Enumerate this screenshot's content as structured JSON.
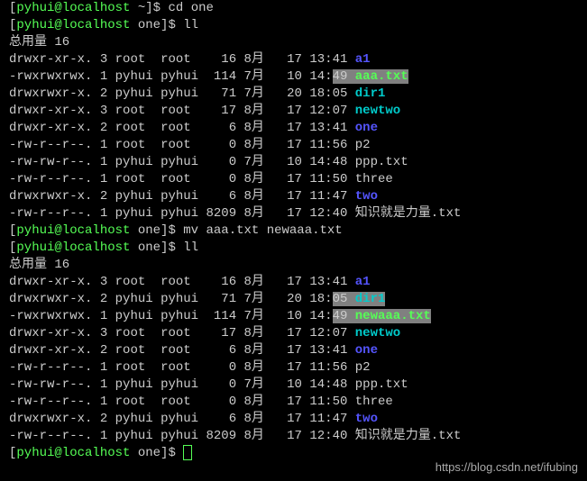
{
  "prompt1": {
    "user": "pyhui",
    "at": "@",
    "host": "localhost",
    "path": " ~]",
    "dollar": "$ ",
    "cmd": "cd one"
  },
  "prompt2": {
    "user": "pyhui",
    "at": "@",
    "host": "localhost",
    "path": " one]",
    "dollar": "$ ",
    "cmd": "ll"
  },
  "total1": "总用量 16",
  "ls1": [
    {
      "perm": "drwxr-xr-x.",
      "l": "3",
      "u": "root ",
      "g": "root ",
      "sz": "  16",
      "m": "8月 ",
      "d": "17",
      "t": "13:",
      "mm": "41",
      "name": "a1",
      "cls": "dir"
    },
    {
      "perm": "-rwxrwxrwx.",
      "l": "1",
      "u": "pyhui",
      "g": "pyhui",
      "sz": " 114",
      "m": "7月 ",
      "d": "10",
      "t": "14:",
      "mm": "49",
      "name": "aaa.txt",
      "cls": "fileg",
      "hl": true
    },
    {
      "perm": "drwxrwxr-x.",
      "l": "2",
      "u": "pyhui",
      "g": "pyhui",
      "sz": "  71",
      "m": "7月 ",
      "d": "20",
      "t": "18:",
      "mm": "05",
      "name": "dir1",
      "cls": "dirteal"
    },
    {
      "perm": "drwxr-xr-x.",
      "l": "3",
      "u": "root ",
      "g": "root ",
      "sz": "  17",
      "m": "8月 ",
      "d": "17",
      "t": "12:",
      "mm": "07",
      "name": "newtwo",
      "cls": "dirteal"
    },
    {
      "perm": "drwxr-xr-x.",
      "l": "2",
      "u": "root ",
      "g": "root ",
      "sz": "   6",
      "m": "8月 ",
      "d": "17",
      "t": "13:",
      "mm": "41",
      "name": "one",
      "cls": "dir"
    },
    {
      "perm": "-rw-r--r--.",
      "l": "1",
      "u": "root ",
      "g": "root ",
      "sz": "   0",
      "m": "8月 ",
      "d": "17",
      "t": "11:",
      "mm": "56",
      "name": "p2",
      "cls": "normal"
    },
    {
      "perm": "-rw-rw-r--.",
      "l": "1",
      "u": "pyhui",
      "g": "pyhui",
      "sz": "   0",
      "m": "7月 ",
      "d": "10",
      "t": "14:",
      "mm": "48",
      "name": "ppp.txt",
      "cls": "normal"
    },
    {
      "perm": "-rw-r--r--.",
      "l": "1",
      "u": "root ",
      "g": "root ",
      "sz": "   0",
      "m": "8月 ",
      "d": "17",
      "t": "11:",
      "mm": "50",
      "name": "three",
      "cls": "normal"
    },
    {
      "perm": "drwxrwxr-x.",
      "l": "2",
      "u": "pyhui",
      "g": "pyhui",
      "sz": "   6",
      "m": "8月 ",
      "d": "17",
      "t": "11:",
      "mm": "47",
      "name": "two",
      "cls": "dir"
    },
    {
      "perm": "-rw-r--r--.",
      "l": "1",
      "u": "pyhui",
      "g": "pyhui",
      "sz": "8209",
      "m": "8月 ",
      "d": "17",
      "t": "12:",
      "mm": "40",
      "name": "知识就是力量.txt",
      "cls": "normal"
    }
  ],
  "prompt3": {
    "user": "pyhui",
    "at": "@",
    "host": "localhost",
    "path": " one]",
    "dollar": "$ ",
    "cmd": "mv aaa.txt newaaa.txt"
  },
  "prompt4": {
    "user": "pyhui",
    "at": "@",
    "host": "localhost",
    "path": " one]",
    "dollar": "$ ",
    "cmd": "ll"
  },
  "total2": "总用量 16",
  "ls2": [
    {
      "perm": "drwxr-xr-x.",
      "l": "3",
      "u": "root ",
      "g": "root ",
      "sz": "  16",
      "m": "8月 ",
      "d": "17",
      "t": "13:",
      "mm": "41",
      "name": "a1",
      "cls": "dir"
    },
    {
      "perm": "drwxrwxr-x.",
      "l": "2",
      "u": "pyhui",
      "g": "pyhui",
      "sz": "  71",
      "m": "7月 ",
      "d": "20",
      "t": "18:",
      "mm": "05",
      "name": "dir1",
      "cls": "dirteal",
      "hl": true
    },
    {
      "perm": "-rwxrwxrwx.",
      "l": "1",
      "u": "pyhui",
      "g": "pyhui",
      "sz": " 114",
      "m": "7月 ",
      "d": "10",
      "t": "14:",
      "mm": "49",
      "name": "newaaa.txt",
      "cls": "fileg",
      "hl": true
    },
    {
      "perm": "drwxr-xr-x.",
      "l": "3",
      "u": "root ",
      "g": "root ",
      "sz": "  17",
      "m": "8月 ",
      "d": "17",
      "t": "12:",
      "mm": "07",
      "name": "newtwo",
      "cls": "dirteal"
    },
    {
      "perm": "drwxr-xr-x.",
      "l": "2",
      "u": "root ",
      "g": "root ",
      "sz": "   6",
      "m": "8月 ",
      "d": "17",
      "t": "13:",
      "mm": "41",
      "name": "one",
      "cls": "dir"
    },
    {
      "perm": "-rw-r--r--.",
      "l": "1",
      "u": "root ",
      "g": "root ",
      "sz": "   0",
      "m": "8月 ",
      "d": "17",
      "t": "11:",
      "mm": "56",
      "name": "p2",
      "cls": "normal"
    },
    {
      "perm": "-rw-rw-r--.",
      "l": "1",
      "u": "pyhui",
      "g": "pyhui",
      "sz": "   0",
      "m": "7月 ",
      "d": "10",
      "t": "14:",
      "mm": "48",
      "name": "ppp.txt",
      "cls": "normal"
    },
    {
      "perm": "-rw-r--r--.",
      "l": "1",
      "u": "root ",
      "g": "root ",
      "sz": "   0",
      "m": "8月 ",
      "d": "17",
      "t": "11:",
      "mm": "50",
      "name": "three",
      "cls": "normal"
    },
    {
      "perm": "drwxrwxr-x.",
      "l": "2",
      "u": "pyhui",
      "g": "pyhui",
      "sz": "   6",
      "m": "8月 ",
      "d": "17",
      "t": "11:",
      "mm": "47",
      "name": "two",
      "cls": "dir"
    },
    {
      "perm": "-rw-r--r--.",
      "l": "1",
      "u": "pyhui",
      "g": "pyhui",
      "sz": "8209",
      "m": "8月 ",
      "d": "17",
      "t": "12:",
      "mm": "40",
      "name": "知识就是力量.txt",
      "cls": "normal"
    }
  ],
  "prompt5": {
    "user": "pyhui",
    "at": "@",
    "host": "localhost",
    "path": " one]",
    "dollar": "$ "
  },
  "watermark": "https://blog.csdn.net/ifubing"
}
